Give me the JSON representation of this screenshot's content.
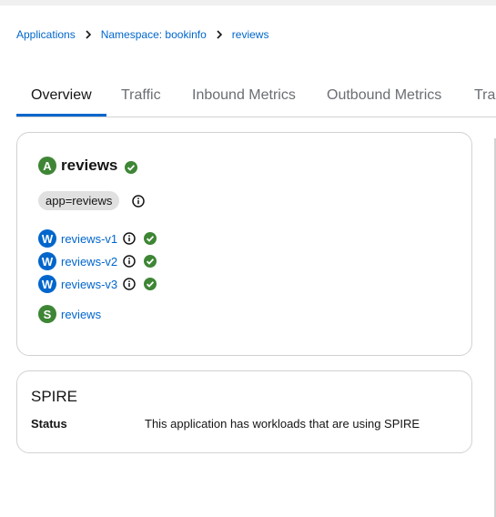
{
  "breadcrumb": {
    "items": [
      "Applications",
      "Namespace: bookinfo",
      "reviews"
    ]
  },
  "tabs": [
    "Overview",
    "Traffic",
    "Inbound Metrics",
    "Outbound Metrics",
    "Traces"
  ],
  "active_tab": "Overview",
  "app": {
    "badge": "A",
    "name": "reviews",
    "health": "healthy",
    "label": "app=reviews",
    "workloads": [
      {
        "badge": "W",
        "name": "reviews-v1",
        "health": "healthy"
      },
      {
        "badge": "W",
        "name": "reviews-v2",
        "health": "healthy"
      },
      {
        "badge": "W",
        "name": "reviews-v3",
        "health": "healthy"
      }
    ],
    "services": [
      {
        "badge": "S",
        "name": "reviews"
      }
    ]
  },
  "spire": {
    "title": "SPIRE",
    "status_label": "Status",
    "status_value": "This application has workloads that are using SPIRE"
  },
  "colors": {
    "link": "#0066cc",
    "healthy": "#3e8635",
    "workload_badge": "#0066cc",
    "app_badge": "#3e8635"
  },
  "icons": {
    "breadcrumb_separator": "chevron-right-icon",
    "health": "check-circle-icon",
    "info": "info-circle-icon"
  }
}
